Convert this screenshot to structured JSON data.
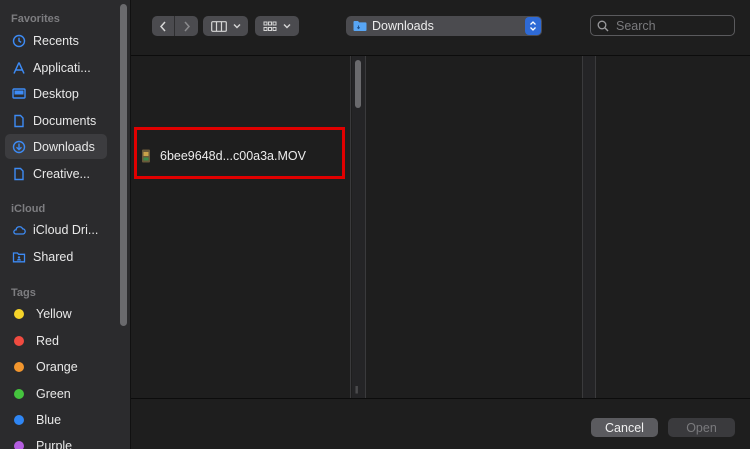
{
  "sidebar": {
    "sections": {
      "favorites": "Favorites",
      "icloud": "iCloud",
      "tags": "Tags"
    },
    "favorites": [
      {
        "label": "Recents",
        "icon": "clock-icon"
      },
      {
        "label": "Applicati...",
        "icon": "applications-icon"
      },
      {
        "label": "Desktop",
        "icon": "desktop-icon"
      },
      {
        "label": "Documents",
        "icon": "document-icon"
      },
      {
        "label": "Downloads",
        "icon": "download-icon"
      },
      {
        "label": "Creative...",
        "icon": "file-icon"
      }
    ],
    "icloud": [
      {
        "label": "iCloud Dri...",
        "icon": "cloud-icon"
      },
      {
        "label": "Shared",
        "icon": "shared-folder-icon"
      }
    ],
    "tags": [
      {
        "label": "Yellow",
        "color": "#f5d32a"
      },
      {
        "label": "Red",
        "color": "#f04b40"
      },
      {
        "label": "Orange",
        "color": "#f2962e"
      },
      {
        "label": "Green",
        "color": "#45c43e"
      },
      {
        "label": "Blue",
        "color": "#2f86f4"
      },
      {
        "label": "Purple",
        "color": "#b45ee0"
      }
    ]
  },
  "toolbar": {
    "back_icon": "chevron-left-icon",
    "forward_icon": "chevron-right-icon",
    "view_icon": "columns-view-icon",
    "group_icon": "grid-icon",
    "location": "Downloads",
    "search_placeholder": "Search"
  },
  "files": [
    {
      "name": "6bee9648d...c00a3a.MOV",
      "icon": "movie-file-icon"
    }
  ],
  "footer": {
    "cancel": "Cancel",
    "open": "Open"
  },
  "colors": {
    "accent": "#2e6ad6",
    "highlight": "#e00000"
  }
}
